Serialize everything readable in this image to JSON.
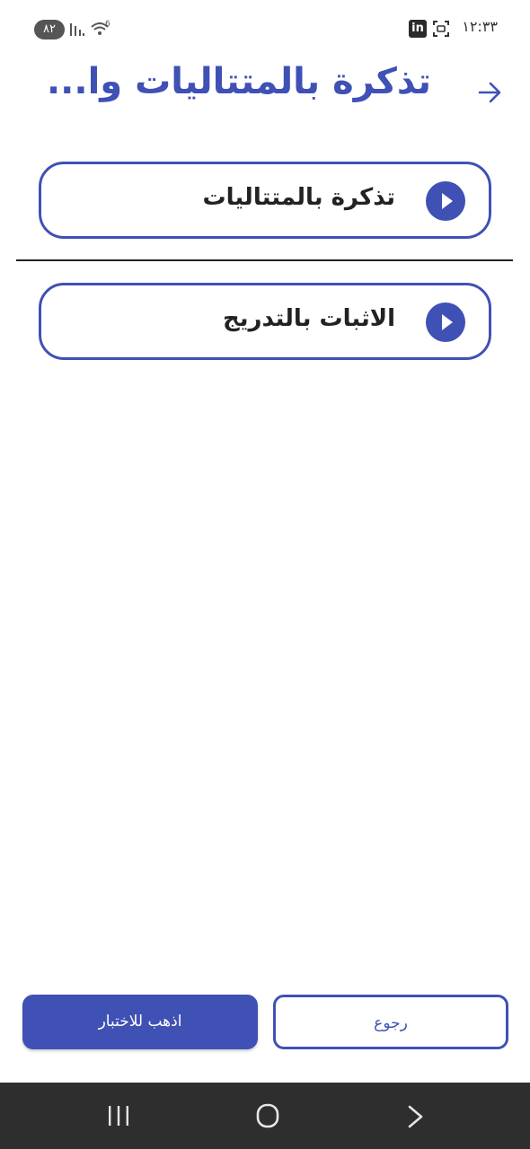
{
  "status_bar": {
    "time": "١٢:٣٣",
    "battery": "٨٢",
    "network": "6",
    "linkedin_badge": "in"
  },
  "header": {
    "title": "تذكرة بالمتتاليات وا...",
    "back_icon": "arrow-right-icon"
  },
  "lessons": [
    {
      "label": "تذكرة بالمتتاليات",
      "icon": "play-circle-icon"
    },
    {
      "label": "الاثبات بالتدريج",
      "icon": "play-circle-icon"
    }
  ],
  "buttons": {
    "go_to_test": "اذهب للاختبار",
    "back": "رجوع"
  },
  "colors": {
    "accent": "#3f51b5",
    "nav_bar": "#2e2e2e"
  }
}
